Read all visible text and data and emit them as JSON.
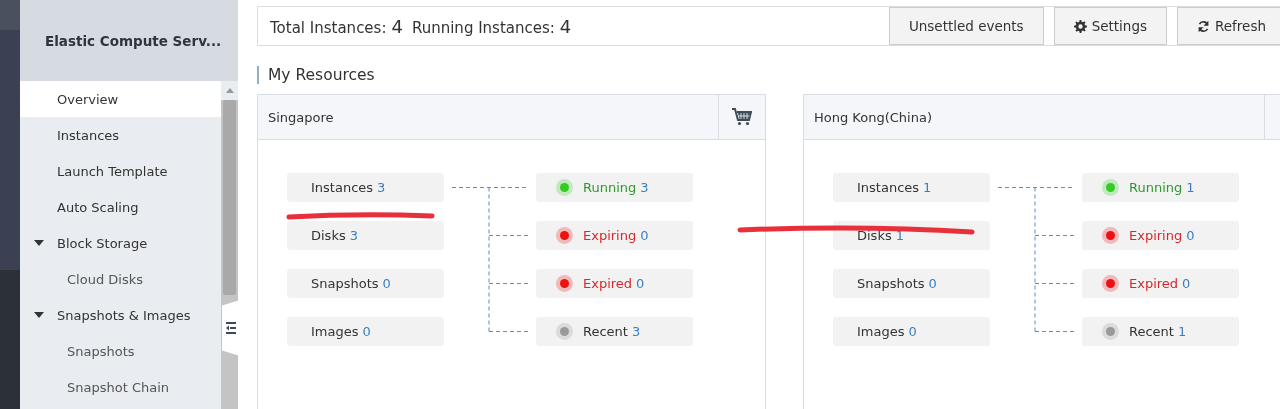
{
  "sidebar": {
    "title": "Elastic Compute Serv...",
    "items": [
      {
        "label": "Overview",
        "selected": true
      },
      {
        "label": "Instances",
        "selected": false
      },
      {
        "label": "Launch Template",
        "selected": false
      },
      {
        "label": "Auto Scaling",
        "selected": false
      },
      {
        "label": "Block Storage",
        "selected": false,
        "expanded": true,
        "children": [
          {
            "label": "Cloud Disks",
            "selected": false
          }
        ]
      },
      {
        "label": "Snapshots & Images",
        "selected": false,
        "expanded": true,
        "children": [
          {
            "label": "Snapshots",
            "selected": false
          },
          {
            "label": "Snapshot Chain",
            "selected": false
          }
        ]
      }
    ]
  },
  "summary": {
    "total_label": "Total Instances:",
    "total": "4",
    "running_label": "Running Instances:",
    "running": "4"
  },
  "buttons": [
    {
      "label": "Unsettled events",
      "kind": "plain"
    },
    {
      "label": "Settings",
      "kind": "settings"
    },
    {
      "label": "Refresh",
      "kind": "refresh"
    }
  ],
  "section_title": "My Resources",
  "regions": [
    {
      "name": "Singapore",
      "cart": true,
      "resources": [
        {
          "label": "Instances",
          "count": "3"
        },
        {
          "label": "Disks",
          "count": "3"
        },
        {
          "label": "Snapshots",
          "count": "0"
        },
        {
          "label": "Images",
          "count": "0"
        }
      ],
      "statuses": [
        {
          "kind": "running",
          "label": "Running",
          "count": "3",
          "color": "#33cc22"
        },
        {
          "kind": "expiring",
          "label": "Expiring",
          "count": "0",
          "color": "#ee1111"
        },
        {
          "kind": "expired",
          "label": "Expired",
          "count": "0",
          "color": "#ee1111"
        },
        {
          "kind": "recent",
          "label": "Recent",
          "count": "3",
          "color": "#999999"
        }
      ]
    },
    {
      "name": "Hong Kong(China)",
      "cart": false,
      "resources": [
        {
          "label": "Instances",
          "count": "1"
        },
        {
          "label": "Disks",
          "count": "1"
        },
        {
          "label": "Snapshots",
          "count": "0"
        },
        {
          "label": "Images",
          "count": "0"
        }
      ],
      "statuses": [
        {
          "kind": "running",
          "label": "Running",
          "count": "1",
          "color": "#33cc22"
        },
        {
          "kind": "expiring",
          "label": "Expiring",
          "count": "0",
          "color": "#ee1111"
        },
        {
          "kind": "expired",
          "label": "Expired",
          "count": "0",
          "color": "#ee1111"
        },
        {
          "kind": "recent",
          "label": "Recent",
          "count": "1",
          "color": "#999999"
        }
      ]
    }
  ]
}
